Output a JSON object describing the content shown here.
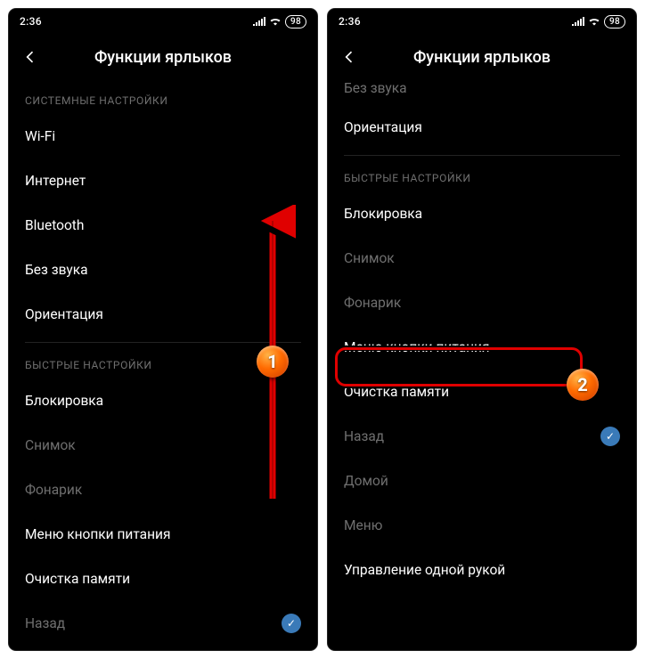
{
  "status": {
    "time": "2:36",
    "battery": "98"
  },
  "title": "Функции ярлыков",
  "screen1": {
    "sections": [
      {
        "header": "СИСТЕМНЫЕ НАСТРОЙКИ",
        "items": [
          {
            "label": "Wi-Fi",
            "dim": false
          },
          {
            "label": "Интернет",
            "dim": false
          },
          {
            "label": "Bluetooth",
            "dim": false
          },
          {
            "label": "Без звука",
            "dim": false
          },
          {
            "label": "Ориентация",
            "dim": false
          }
        ]
      },
      {
        "header": "БЫСТРЫЕ НАСТРОЙКИ",
        "items": [
          {
            "label": "Блокировка",
            "dim": false
          },
          {
            "label": "Снимок",
            "dim": true
          },
          {
            "label": "Фонарик",
            "dim": true
          },
          {
            "label": "Меню кнопки питания",
            "dim": false
          },
          {
            "label": "Очистка памяти",
            "dim": false
          },
          {
            "label": "Назад",
            "dim": true,
            "checked": true
          }
        ]
      }
    ],
    "badge": "1"
  },
  "screen2": {
    "partialTop": "Без звука",
    "topItems": [
      {
        "label": "Ориентация",
        "dim": false
      }
    ],
    "section": {
      "header": "БЫСТРЫЕ НАСТРОЙКИ",
      "items": [
        {
          "label": "Блокировка",
          "dim": false
        },
        {
          "label": "Снимок",
          "dim": true
        },
        {
          "label": "Фонарик",
          "dim": true
        },
        {
          "label": "Меню кнопки питания",
          "dim": false,
          "highlight": true
        },
        {
          "label": "Очистка памяти",
          "dim": false
        },
        {
          "label": "Назад",
          "dim": true,
          "checked": true
        },
        {
          "label": "Домой",
          "dim": true
        },
        {
          "label": "Меню",
          "dim": true
        },
        {
          "label": "Управление одной рукой",
          "dim": false
        }
      ]
    },
    "badge": "2"
  }
}
